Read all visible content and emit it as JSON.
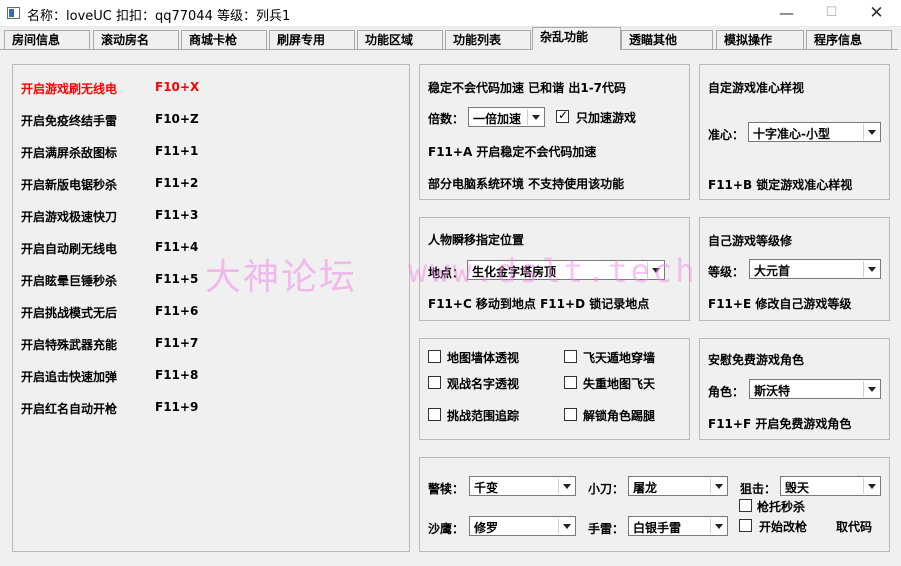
{
  "window": {
    "title": "名称：loveUC 扣扣：qq77044 等级：列兵1",
    "minimize": "—",
    "maximize": "☐",
    "close": "✕"
  },
  "tabs": [
    "房间信息",
    "滚动房名",
    "商城卡枪",
    "刷屏专用",
    "功能区域",
    "功能列表",
    "杂乱功能",
    "透瞄其他",
    "模拟操作",
    "程序信息"
  ],
  "active_tab": "杂乱功能",
  "hotkeys": [
    {
      "label": "开启游戏刷无线电",
      "key": "F10+X"
    },
    {
      "label": "开启免疫终结手雷",
      "key": "F10+Z"
    },
    {
      "label": "开启满屏杀敌图标",
      "key": "F11+1"
    },
    {
      "label": "开启新版电锯秒杀",
      "key": "F11+2"
    },
    {
      "label": "开启游戏极速快刀",
      "key": "F11+3"
    },
    {
      "label": "开启自动刷无线电",
      "key": "F11+4"
    },
    {
      "label": "开启眩晕巨锤秒杀",
      "key": "F11+5"
    },
    {
      "label": "开启挑战模式无后",
      "key": "F11+6"
    },
    {
      "label": "开启特殊武器充能",
      "key": "F11+7"
    },
    {
      "label": "开启追击快速加弹",
      "key": "F11+8"
    },
    {
      "label": "开启红名自动开枪",
      "key": "F11+9"
    }
  ],
  "speed": {
    "title": "稳定不会代码加速 已和谐 出1-7代码",
    "multiplier_label": "倍数：",
    "multiplier_value": "一倍加速",
    "only_game_label": "只加速游戏",
    "hotkey_line": "F11+A 开启稳定不会代码加速",
    "note": "部分电脑系统环境 不支持使用该功能"
  },
  "crosshair": {
    "title": "自定游戏准心样视",
    "label": "准心：",
    "value": "十字准心-小型",
    "hotkey_line": "F11+B 锁定游戏准心样视"
  },
  "teleport": {
    "title": "人物瞬移指定位置",
    "label": "地点：",
    "value": "生化金字塔房顶",
    "hotkey_line": "F11+C 移动到地点 F11+D 锁记录地点"
  },
  "level": {
    "title": "自己游戏等级修",
    "label": "等级：",
    "value": "大元首",
    "hotkey_line": "F11+E 修改自己游戏等级"
  },
  "options": [
    {
      "label": "地图墙体透视",
      "checked": false
    },
    {
      "label": "飞天遁地穿墙",
      "checked": false
    },
    {
      "label": "观战名字透视",
      "checked": false
    },
    {
      "label": "失重地图飞天",
      "checked": false
    },
    {
      "label": "挑战范围追踪",
      "checked": false
    },
    {
      "label": "解锁角色踢腿",
      "checked": false
    }
  ],
  "role": {
    "title": "安慰免费游戏角色",
    "label": "角色：",
    "value": "斯沃特",
    "hotkey_line": "F11+F 开启免费游戏角色"
  },
  "weapons": {
    "sniper_label": "警犊：",
    "sniper_value": "千变",
    "knife_label": "小刀：",
    "knife_value": "屠龙",
    "rifle_label": "狙击：",
    "rifle_value": "毁天",
    "shotgun_label": "沙鹰：",
    "shotgun_value": "修罗",
    "grenade_label": "手雷：",
    "grenade_value": "白银手雷",
    "gunstock_label": "枪托秒杀",
    "start_label": "开始改枪",
    "get_code_label": "取代码"
  },
  "watermark": {
    "cn": "大神论坛",
    "url": "www.dslt.tech"
  },
  "colors": {
    "highlight": "#ff0000",
    "watermark": "#f08ce6"
  }
}
